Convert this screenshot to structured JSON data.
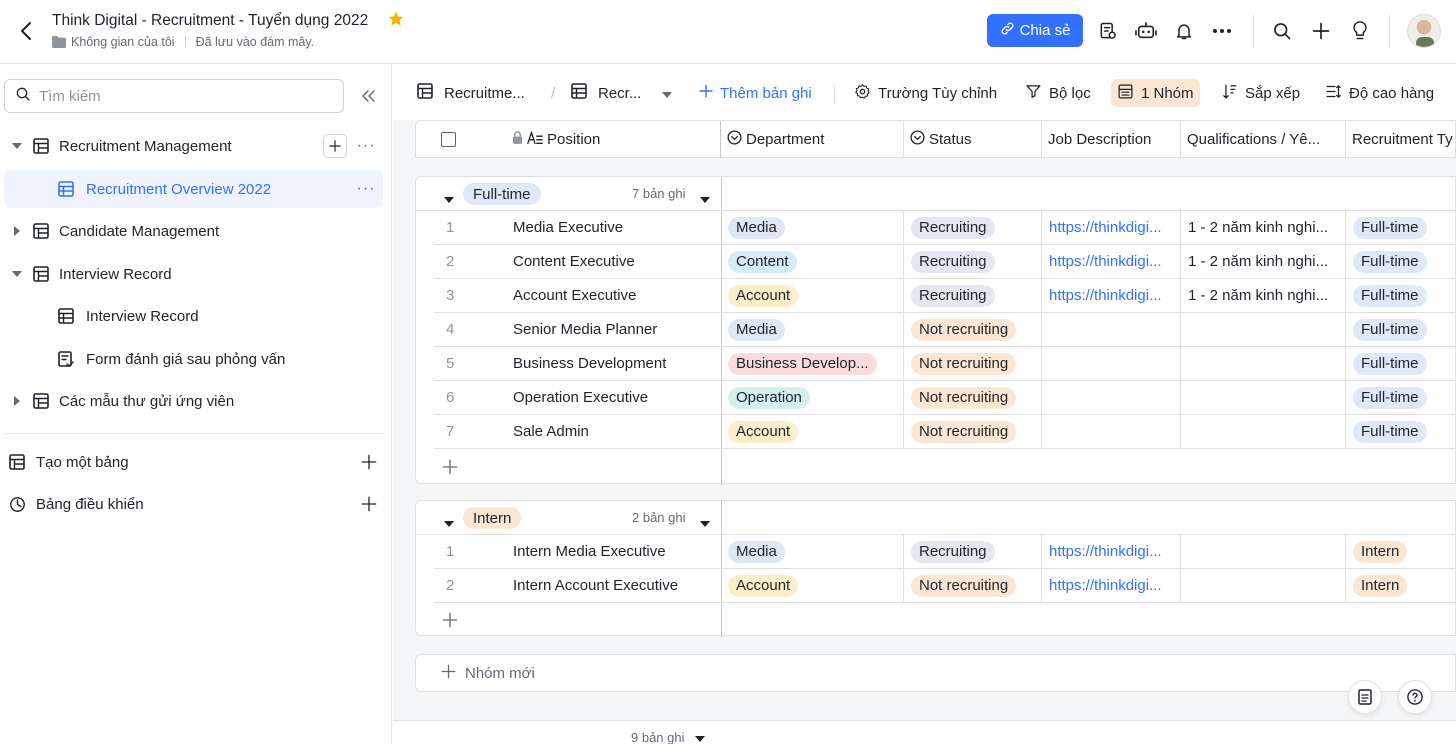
{
  "header": {
    "title": "Think Digital - Recruitment - Tuyển dụng 2022",
    "workspace": "Không gian của tôi",
    "save_status": "Đã lưu vào đám mây.",
    "share_label": "Chia sẻ"
  },
  "sidebar": {
    "search_placeholder": "Tìm kiếm",
    "items": [
      {
        "label": "Recruitment Management"
      },
      {
        "label": "Recruitment Overview 2022"
      },
      {
        "label": "Candidate Management"
      },
      {
        "label": "Interview Record"
      },
      {
        "label": "Interview Record"
      },
      {
        "label": "Form đánh giá sau phỏng vấn"
      },
      {
        "label": "Các mẫu thư gửi ứng viên"
      }
    ],
    "create_table": "Tạo một bảng",
    "dashboard": "Bảng điều khiển"
  },
  "toolbar": {
    "table_tab": "Recruitme...",
    "view_tab": "Recr...",
    "add_record": "Thêm bản ghi",
    "custom_fields": "Trường Tùy chỉnh",
    "filter": "Bộ lọc",
    "group": "1 Nhóm",
    "sort": "Sắp xếp",
    "row_height": "Độ cao hàng"
  },
  "columns": [
    "Position",
    "Department",
    "Status",
    "Job Description",
    "Qualifications / Yê...",
    "Recruitment Ty"
  ],
  "groups": [
    {
      "name": "Full-time",
      "count_label": "7 bản ghi",
      "rows": [
        {
          "idx": "1",
          "position": "Media Executive",
          "department": "Media",
          "status": "Recruiting",
          "jd": "https://thinkdigi...",
          "qual": "1 - 2 năm kinh nghi...",
          "type": "Full-time"
        },
        {
          "idx": "2",
          "position": "Content Executive",
          "department": "Content",
          "status": "Recruiting",
          "jd": "https://thinkdigi...",
          "qual": "1 - 2 năm kinh nghi...",
          "type": "Full-time"
        },
        {
          "idx": "3",
          "position": "Account Executive",
          "department": "Account",
          "status": "Recruiting",
          "jd": "https://thinkdigi...",
          "qual": "1 - 2 năm kinh nghi...",
          "type": "Full-time"
        },
        {
          "idx": "4",
          "position": "Senior Media Planner",
          "department": "Media",
          "status": "Not recruiting",
          "jd": "",
          "qual": "",
          "type": "Full-time"
        },
        {
          "idx": "5",
          "position": "Business Development",
          "department": "Business Develop...",
          "status": "Not recruiting",
          "jd": "",
          "qual": "",
          "type": "Full-time"
        },
        {
          "idx": "6",
          "position": "Operation Executive",
          "department": "Operation",
          "status": "Not recruiting",
          "jd": "",
          "qual": "",
          "type": "Full-time"
        },
        {
          "idx": "7",
          "position": "Sale Admin",
          "department": "Account",
          "status": "Not recruiting",
          "jd": "",
          "qual": "",
          "type": "Full-time"
        }
      ]
    },
    {
      "name": "Intern",
      "count_label": "2 bản ghi",
      "rows": [
        {
          "idx": "1",
          "position": "Intern Media Executive",
          "department": "Media",
          "status": "Recruiting",
          "jd": "https://thinkdigi...",
          "qual": "",
          "type": "Intern"
        },
        {
          "idx": "2",
          "position": "Intern Account Executive",
          "department": "Account",
          "status": "Not recruiting",
          "jd": "https://thinkdigi...",
          "qual": "",
          "type": "Intern"
        }
      ]
    }
  ],
  "new_group": "Nhóm mới",
  "total_records": "9 bản ghi",
  "colors": {
    "accent": "#3370ff",
    "Media": "#dfe6f5",
    "Content": "#d3ecf5",
    "Account": "#fbefc9",
    "Business Develop...": "#fbdcdc",
    "Operation": "#d2f0ec",
    "Recruiting": "#e4e7f2",
    "Not recruiting": "#fbe6d4",
    "Full-time": "#dfe8f8",
    "Intern": "#fbe6d4"
  }
}
